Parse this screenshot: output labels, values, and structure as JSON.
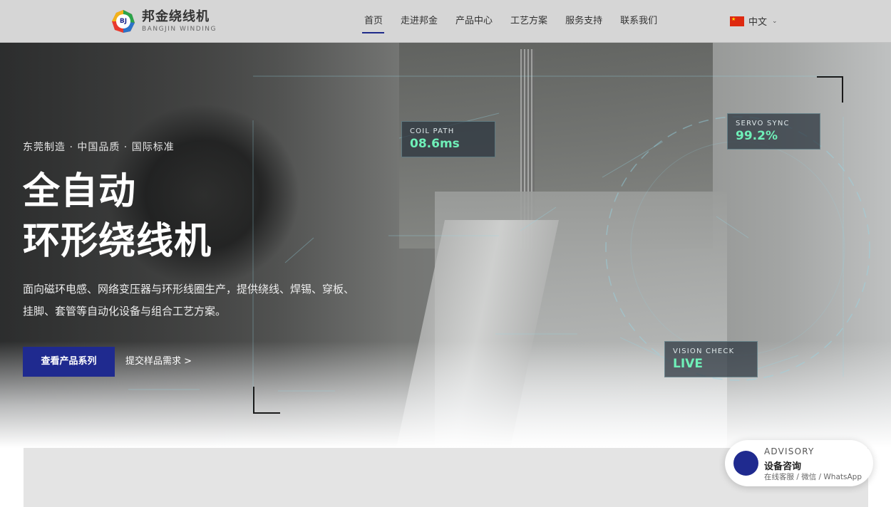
{
  "header": {
    "logo_badge": "BJ",
    "logo_cn": "邦金绕线机",
    "logo_en": "BANGJIN WINDING",
    "nav": [
      {
        "label": "首页",
        "active": true
      },
      {
        "label": "走进邦金"
      },
      {
        "label": "产品中心"
      },
      {
        "label": "工艺方案"
      },
      {
        "label": "服务支持"
      },
      {
        "label": "联系我们"
      }
    ],
    "language": "中文"
  },
  "hero": {
    "tagline": "东莞制造 · 中国品质 · 国际标准",
    "title_line1": "全自动",
    "title_line2": "环形绕线机",
    "description": "面向磁环电感、网络变压器与环形线圈生产，提供绕线、焊锡、穿板、挂脚、套管等自动化设备与组合工艺方案。",
    "primary_button": "查看产品系列",
    "secondary_link": "提交样品需求 >"
  },
  "hud": [
    {
      "label": "COIL PATH",
      "value": "08.6ms"
    },
    {
      "label": "SERVO SYNC",
      "value": "99.2%"
    },
    {
      "label": "VISION CHECK",
      "value": "LIVE"
    }
  ],
  "advisory": {
    "eyebrow": "ADVISORY",
    "title": "设备咨询",
    "subtitle": "在线客服 / 微信 / WhatsApp"
  },
  "colors": {
    "brand": "#1f2a8f",
    "hud_value": "#6ff0b8",
    "header_bg": "#d6d6d6"
  }
}
